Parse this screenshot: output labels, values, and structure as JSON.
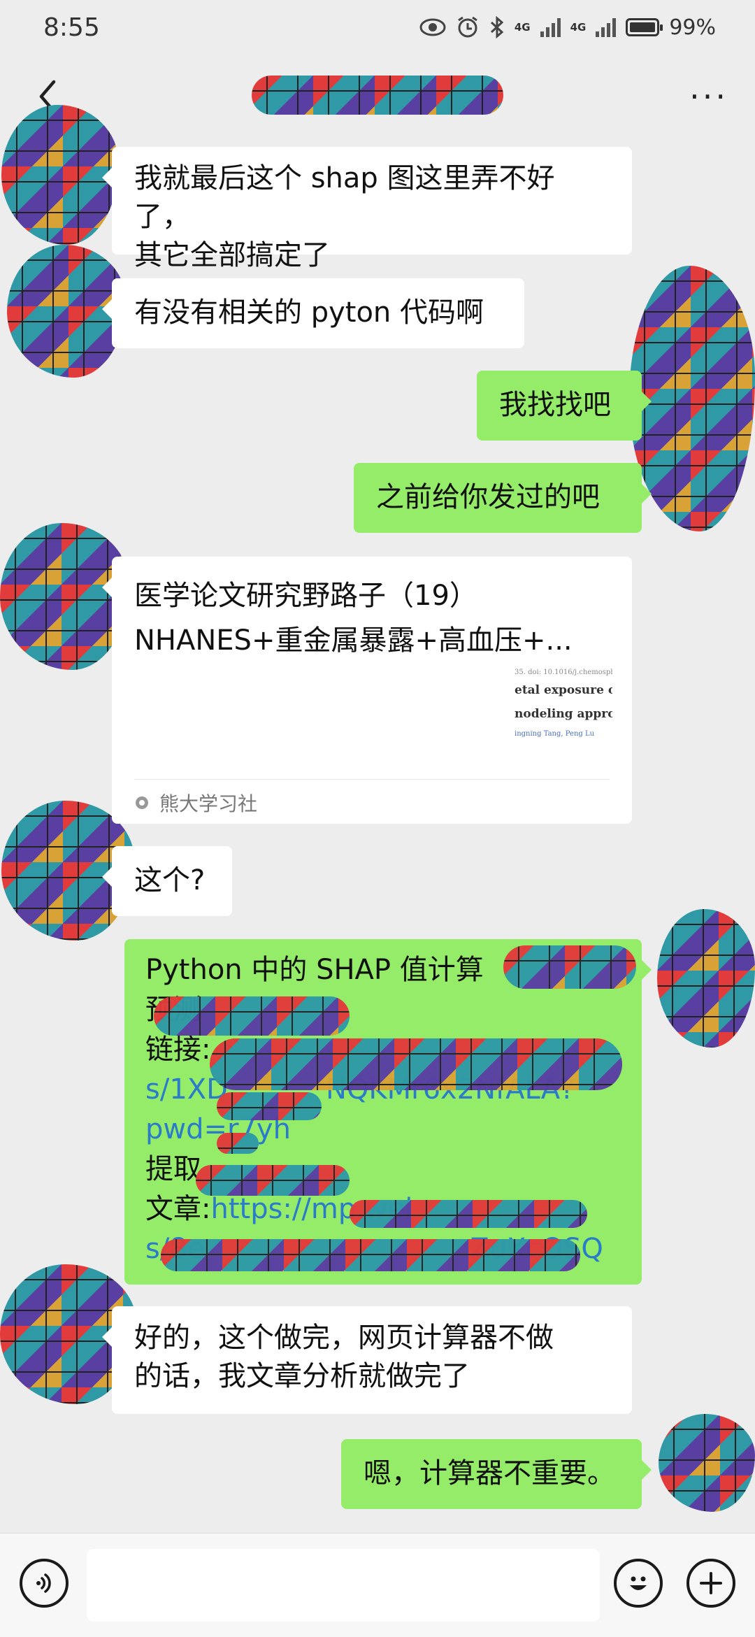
{
  "status": {
    "time": "8:55",
    "net1": "4G",
    "net2": "4G",
    "battery": "99%"
  },
  "nav": {
    "back_icon": "chevron-left-icon",
    "more_label": "···"
  },
  "messages": {
    "m1": {
      "lines": [
        "我就最后这个 shap 图这里弄不好了，",
        "其它全部搞定了"
      ]
    },
    "m2": {
      "text": "有没有相关的 pyton 代码啊"
    },
    "m3": {
      "text": "我找找吧"
    },
    "m4": {
      "text": "之前给你发过的吧"
    },
    "m5": {
      "title": "医学论文研究野路子（19）",
      "subtitle": "NHANES+重金属暴露+高血压+...",
      "thumb_doi": "35. doi: 10.1016/j.chemosph",
      "thumb_line1": "etal exposure o",
      "thumb_line2": "nodeling appro",
      "thumb_authors": "ingning Tang, Peng Lu",
      "source": "熊大学习社"
    },
    "m6": {
      "text": "这个?"
    },
    "m7": {
      "line1": "Python 中的 SHAP 值计算",
      "line2": "预测",
      "line3_label": "链接:",
      "line4": "s/1XD",
      "line4b": "NQKMr6x2NfALA?",
      "line5": "pwd=r7yh",
      "line6_label": "提取",
      "line7_label": "文章:",
      "line7_url": "https://mp.wei",
      "line8": "s/8e",
      "line8b": "ZuXcOSQ"
    },
    "m8": {
      "lines": [
        "好的，这个做完，网页计算器不做",
        "的话，我文章分析就做完了"
      ]
    },
    "m9": {
      "text": "嗯，计算器不重要。"
    }
  },
  "input": {
    "placeholder": ""
  },
  "colors": {
    "outgoing": "#95ec69",
    "incoming": "#ffffff",
    "background": "#ededed"
  }
}
